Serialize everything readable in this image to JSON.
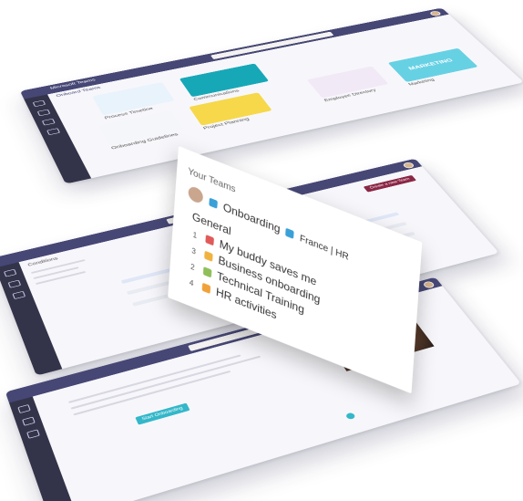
{
  "app": {
    "title": "Microsoft Teams",
    "tab_title": "Onboard Teams"
  },
  "card": {
    "header": "Your Teams",
    "team_title": "Onboarding",
    "team_right": "France | HR",
    "channels": [
      {
        "number": "",
        "label": "General"
      },
      {
        "number": "1",
        "label": "My buddy saves me"
      },
      {
        "number": "3",
        "label": "Business onboarding"
      },
      {
        "number": "2",
        "label": "Technical Training"
      },
      {
        "number": "4",
        "label": "HR activities"
      }
    ]
  },
  "top_screen": {
    "tiles": [
      {
        "label": "Process Timeline",
        "color": "#e9f3fb"
      },
      {
        "label": "Communications",
        "color": "#17a8b8"
      },
      {
        "label": "Onboarding Guidelines",
        "color": "#f4f6fa"
      },
      {
        "label": "Project Planning",
        "color": "#f6d84a"
      },
      {
        "label": "Employee Directory",
        "color": "#f2e9f6"
      },
      {
        "label": "Marketing",
        "color": "#67d1e4"
      }
    ],
    "marketing_text": "MARKETING"
  },
  "middle_screen": {
    "left_heading": "Conditions",
    "button_label": "Create a new Team"
  },
  "bottom_screen": {
    "button_label": "Start Onboarding"
  },
  "colors": {
    "brand": "#464775",
    "rail": "#33344a",
    "accent_teal": "#33b7c9",
    "accent_maroon": "#8b2746"
  }
}
